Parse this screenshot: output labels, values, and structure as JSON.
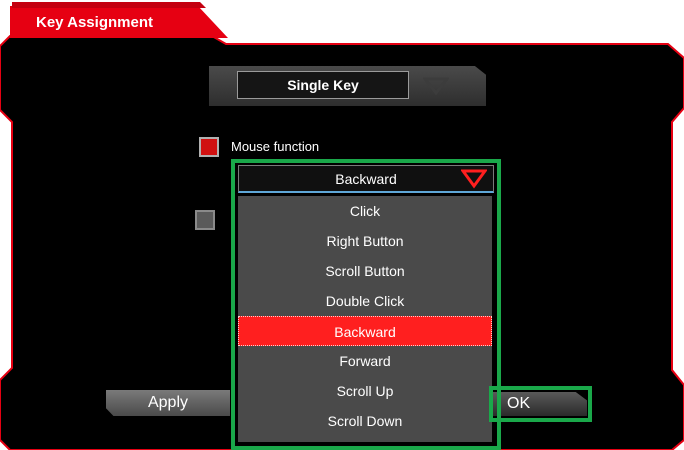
{
  "window": {
    "title": "Key Assignment"
  },
  "mode": {
    "selected": "Single Key"
  },
  "options": {
    "mouse_function_label": "Mouse function",
    "mouse_function_checked": true,
    "second_option_checked": false
  },
  "dropdown": {
    "selected": "Backward",
    "items": [
      "Click",
      "Right Button",
      "Scroll Button",
      "Double Click",
      "Backward",
      "Forward",
      "Scroll Up",
      "Scroll Down"
    ],
    "highlighted_index": 4
  },
  "buttons": {
    "apply": "Apply",
    "ok": "OK"
  },
  "colors": {
    "accent_red": "#e60012",
    "highlight_green": "#1aa84a",
    "background": "#000000"
  }
}
